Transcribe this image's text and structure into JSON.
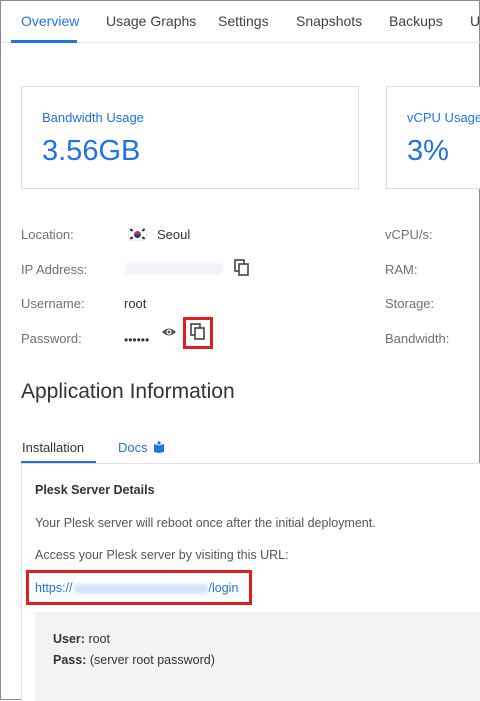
{
  "tabs": [
    {
      "label": "Overview",
      "active": true
    },
    {
      "label": "Usage Graphs"
    },
    {
      "label": "Settings"
    },
    {
      "label": "Snapshots"
    },
    {
      "label": "Backups"
    },
    {
      "label": "Us"
    }
  ],
  "cards": [
    {
      "title": "Bandwidth Usage",
      "value": "3.56GB"
    },
    {
      "title": "vCPU Usage",
      "value": "3%"
    }
  ],
  "info": {
    "location_label": "Location:",
    "location_value": "Seoul",
    "ip_label": "IP Address:",
    "username_label": "Username:",
    "username_value": "root",
    "password_label": "Password:",
    "password_mask": "••••••",
    "right_labels": [
      "vCPU/s:",
      "RAM:",
      "Storage:",
      "Bandwidth:"
    ]
  },
  "app": {
    "heading": "Application Information",
    "subtabs": [
      {
        "label": "Installation",
        "active": true
      },
      {
        "label": "Docs"
      }
    ],
    "panel_title": "Plesk Server Details",
    "reboot_text": "Your Plesk server will reboot once after the initial deployment.",
    "access_text": "Access your Plesk server by visiting this URL:",
    "url_prefix": "https://",
    "url_suffix": "/login",
    "user_label": "User:",
    "user_value": " root",
    "pass_label": "Pass:",
    "pass_value": " (server root password)"
  },
  "colors": {
    "accent": "#1f73e8",
    "highlight_box": "#e02020"
  },
  "icons": [
    "copy-icon",
    "eye-icon",
    "book-icon",
    "korea-flag-icon"
  ]
}
